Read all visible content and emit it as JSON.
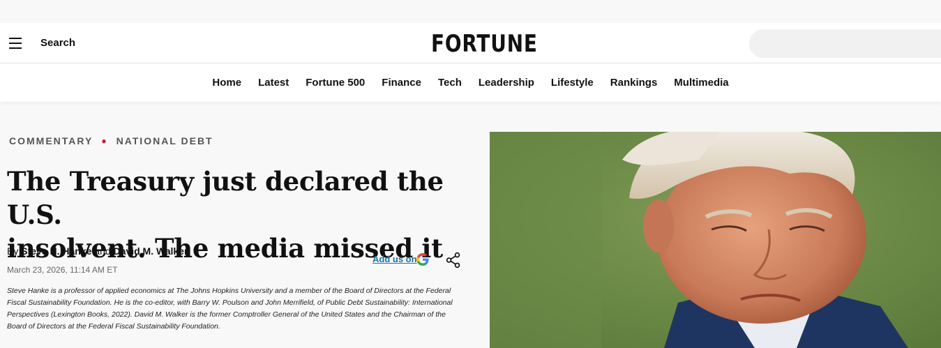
{
  "header": {
    "search_label": "Search",
    "logo_text": "FORTUNE",
    "search_placeholder": ""
  },
  "nav": {
    "items": [
      "Home",
      "Latest",
      "Fortune 500",
      "Finance",
      "Tech",
      "Leadership",
      "Lifestyle",
      "Rankings",
      "Multimedia"
    ]
  },
  "article": {
    "section": "COMMENTARY",
    "topic": "NATIONAL DEBT",
    "headline_line1": "The Treasury just declared the U.S.",
    "headline_line2": "insolvent. The media missed it",
    "by_prefix": "By",
    "author1": "Steve H. Hanke",
    "and_word": "and",
    "author2": "David M. Walker",
    "date": "March 23, 2026, 11:14 AM ET",
    "add_us_label": "Add us on",
    "bio": "Steve Hanke is a professor of applied economics at The Johns Hopkins University and a member of the Board of Directors at the Federal Fiscal Sustainability Foundation. He is the co-editor, with Barry W. Poulson and John Merrifield, of Public Debt Sustainability: International Perspectives (Lexington Books, 2022). David M. Walker is the former Comptroller General of the United States and the Chairman of the Board of Directors at the Federal Fiscal Sustainability Foundation."
  },
  "colors": {
    "kicker_dot": "#d5112a",
    "link": "#1a73a8"
  },
  "icons": {
    "menu": "hamburger-icon",
    "google": "google-g-icon",
    "share": "share-icon"
  }
}
